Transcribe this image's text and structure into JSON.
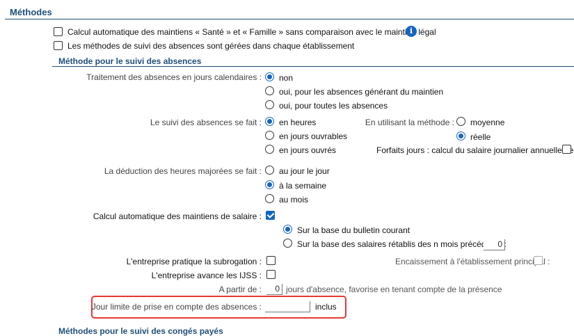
{
  "section": {
    "title": "Méthodes"
  },
  "general": {
    "auto_maintiens_label": "Calcul automatique des maintiens « Santé » et « Famille » sans comparaison avec le maintien légal",
    "methods_per_establishment_label": "Les méthodes de suivi des absences sont gérées dans chaque établissement",
    "info_icon_glyph": "i"
  },
  "subsection": {
    "title": "Méthode pour le suivi des absences"
  },
  "calendar_days": {
    "label": "Traitement des absences en jours calendaires :",
    "options": [
      "non",
      "oui, pour les absences générant du maintien",
      "oui, pour toutes les absences"
    ],
    "selected": "non"
  },
  "tracking": {
    "label": "Le suivi des absences se fait :",
    "options": [
      "en heures",
      "en jours ouvrables",
      "en jours ouvrés"
    ],
    "selected": "en heures"
  },
  "method": {
    "label": "En utilisant la méthode :",
    "options": [
      "moyenne",
      "réelle"
    ],
    "selected": "réelle"
  },
  "forfaits": {
    "label": "Forfaits jours : calcul du salaire journalier annuellement :"
  },
  "deduction": {
    "label": "La déduction des heures majorées se fait :",
    "options": [
      "au jour le jour",
      "à la semaine",
      "au mois"
    ],
    "selected": "à la semaine"
  },
  "auto_salary": {
    "label": "Calcul automatique des maintiens de salaire :",
    "options": [
      "Sur la base du bulletin courant",
      "Sur la base des salaires rétablis des n mois précédents :"
    ],
    "selected": "Sur la base du bulletin courant",
    "n_months_value": "0"
  },
  "subrogation": {
    "label": "L'entreprise pratique la subrogation :"
  },
  "encaissement": {
    "label": "Encaissement à l'établissement principal :"
  },
  "ijss": {
    "label": "L'entreprise avance les IJSS :"
  },
  "a_partir": {
    "label": "A partir de :",
    "value": "0",
    "suffix": "jours d'absence, favorise en tenant compte de la présence"
  },
  "jour_limite": {
    "label": "Jour limite de prise en compte des absences :",
    "value": "",
    "suffix": "inclus"
  },
  "next_section": {
    "title": "Méthodes pour le suivi des congés payés"
  },
  "colors": {
    "accent": "#1565c0",
    "heading": "#1f4e79",
    "highlight": "#e53935"
  }
}
